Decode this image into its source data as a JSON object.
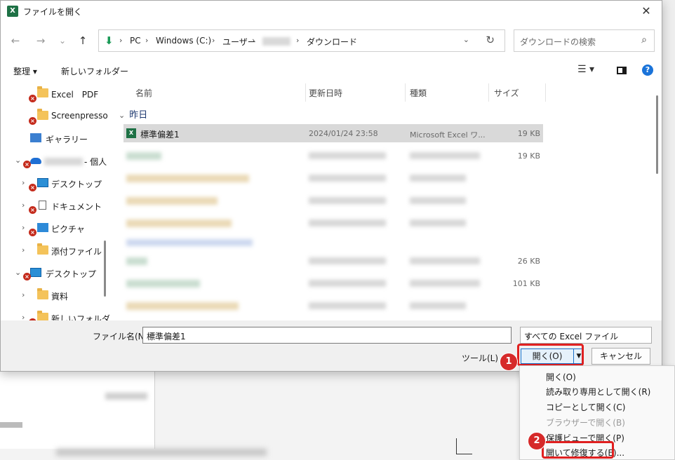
{
  "window": {
    "title": "ファイルを開く",
    "app_icon": "X",
    "close": "✕"
  },
  "nav": {
    "back": "←",
    "forward": "→",
    "recent": "⌄",
    "up": "↑",
    "crumbs": [
      "PC",
      "Windows (C:)",
      "ユーザー",
      "ダウンロード"
    ],
    "separator": "›",
    "download_icon": "⬇",
    "dropdown": "⌄",
    "refresh": "↻",
    "search_placeholder": "ダウンロードの検索",
    "search_icon": "⌕"
  },
  "toolbar": {
    "organize": "整理 ▾",
    "new_folder": "新しいフォルダー",
    "view": "☰ ▾",
    "help": "?"
  },
  "sidebar": {
    "items": [
      {
        "label": "Excel　PDF",
        "icon": "folder-icon",
        "err": true
      },
      {
        "label": "Screenpresso",
        "icon": "folder-icon",
        "err": true
      },
      {
        "label": "ギャラリー",
        "icon": "gallery-icon",
        "err": false
      },
      {
        "label": "- 個人",
        "icon": "onedrive-icon",
        "err": true,
        "expanded": true
      },
      {
        "label": "デスクトップ",
        "icon": "desktop-icon",
        "err": true
      },
      {
        "label": "ドキュメント",
        "icon": "document-icon",
        "err": true
      },
      {
        "label": "ピクチャ",
        "icon": "pictures-icon",
        "err": true
      },
      {
        "label": "添付ファイル",
        "icon": "folder-icon",
        "err": false
      },
      {
        "label": "デスクトップ",
        "icon": "desktop-icon",
        "err": true,
        "expanded": true
      },
      {
        "label": "資料",
        "icon": "folder-icon",
        "err": false
      },
      {
        "label": "新しいフォルダー",
        "icon": "folder-icon",
        "err": true
      }
    ],
    "err_glyph": "×",
    "chev_closed": "›",
    "chev_open": "⌄"
  },
  "columns": {
    "name": "名前",
    "modified": "更新日時",
    "type": "種類",
    "size": "サイズ",
    "sort": "⌃"
  },
  "group": {
    "label": "昨日",
    "chev": "⌄"
  },
  "files": [
    {
      "name": "標準偏差1",
      "modified": "2024/01/24 23:58",
      "type": "Microsoft Excel ワ...",
      "size": "19 KB",
      "selected": true,
      "xls_glyph": "X"
    },
    {
      "size": "19 KB"
    },
    {
      "size": "26 KB"
    },
    {
      "size": "101 KB"
    }
  ],
  "bottom": {
    "filename_label": "ファイル名(N):",
    "filename_value": "標準偏差1",
    "filetype_value": "すべての Excel ファイル",
    "dd": "⌄",
    "tools": "ツール(L)",
    "open": "開く(O)",
    "open_arrow": "▼",
    "cancel": "キャンセル"
  },
  "menu": {
    "items": [
      {
        "label": "開く(O)",
        "enabled": true
      },
      {
        "label": "読み取り専用として開く(R)",
        "enabled": true
      },
      {
        "label": "コピーとして開く(C)",
        "enabled": true
      },
      {
        "label": "ブラウザーで開く(B)",
        "enabled": false
      },
      {
        "label": "保護ビューで開く(P)",
        "enabled": true
      },
      {
        "label": "開いて修復する(E)...",
        "enabled": true
      }
    ]
  },
  "badges": [
    "1",
    "2"
  ],
  "colors": {
    "highlight": "#e02020",
    "accent": "#1a6fc9",
    "excel": "#1e7145"
  }
}
